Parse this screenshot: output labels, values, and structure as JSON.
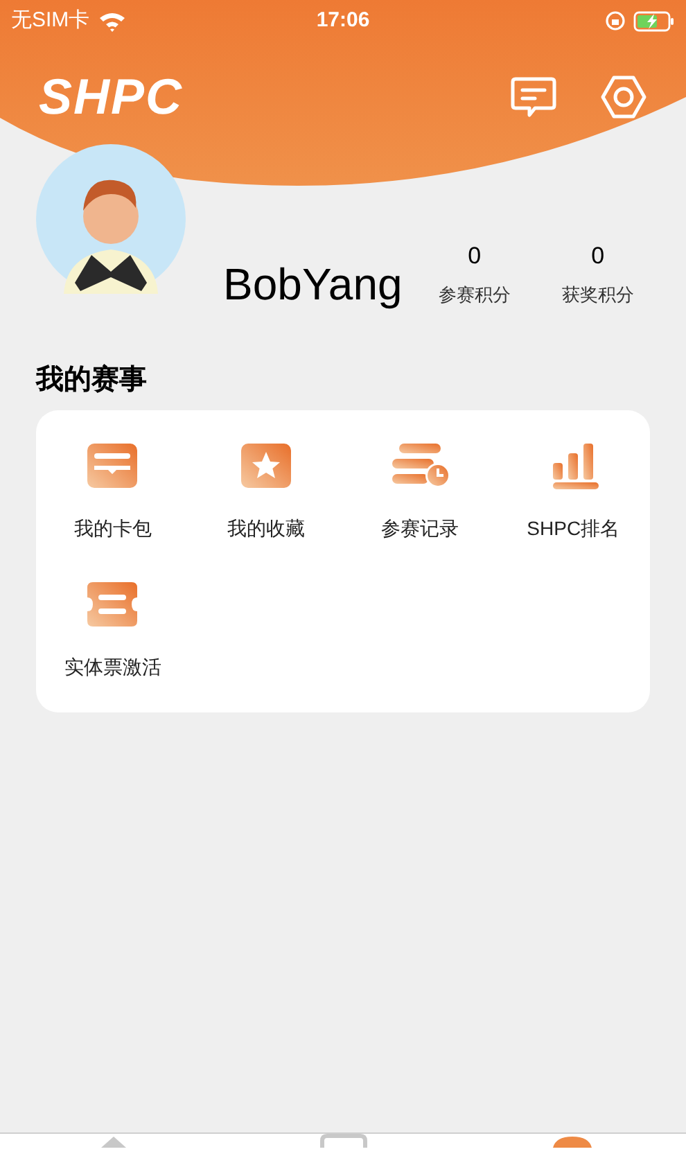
{
  "status_bar": {
    "carrier": "无SIM卡",
    "time": "17:06"
  },
  "header": {
    "logo": "SHPC"
  },
  "profile": {
    "name": "BobYang",
    "stats": [
      {
        "value": "0",
        "label": "参赛积分"
      },
      {
        "value": "0",
        "label": "获奖积分"
      }
    ]
  },
  "section": {
    "title": "我的赛事",
    "items": [
      {
        "kind": "wallet",
        "label": "我的卡包"
      },
      {
        "kind": "favorite",
        "label": "我的收藏"
      },
      {
        "kind": "records",
        "label": "参赛记录"
      },
      {
        "kind": "ranking",
        "label": "SHPC排名"
      },
      {
        "kind": "ticket",
        "label": "实体票激活"
      }
    ]
  },
  "tab_bar": {
    "tabs": [
      {
        "kind": "home",
        "selected": false
      },
      {
        "kind": "square",
        "selected": false
      },
      {
        "kind": "profile",
        "selected": true
      }
    ]
  }
}
